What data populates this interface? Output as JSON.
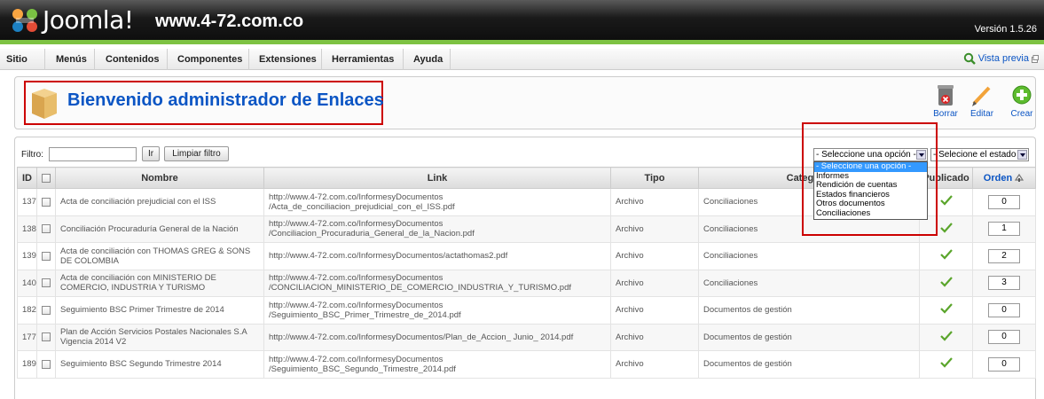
{
  "header": {
    "brand": "Joomla!",
    "site": "www.4-72.com.co",
    "version": "Versión 1.5.26"
  },
  "menu": [
    "Sitio",
    "Menús",
    "Contenidos",
    "Componentes",
    "Extensiones",
    "Herramientas",
    "Ayuda"
  ],
  "preview_label": "Vista previa",
  "page_title": "Bienvenido administrador de Enlaces",
  "toolbar": {
    "delete": "Borrar",
    "edit": "Editar",
    "new": "Crear"
  },
  "filter": {
    "label": "Filtro:",
    "value": "",
    "go": "Ir",
    "reset": "Limpiar filtro",
    "category_select": "- Seleccione una opción -",
    "state_select": "- Selecione el estado -"
  },
  "category_options": [
    "- Seleccione una opción -",
    "Informes",
    "Rendición de cuentas",
    "Estados financieros",
    "Otros documentos",
    "Conciliaciones"
  ],
  "table": {
    "headers": {
      "id": "ID",
      "name": "Nombre",
      "link": "Link",
      "type": "Tipo",
      "category": "Categoría",
      "published": "Publicado",
      "order": "Orden"
    },
    "rows": [
      {
        "id": "137",
        "name": "Acta de conciliación prejudicial con el ISS",
        "link": "http://www.4-72.com.co/InformesyDocumentos\n/Acta_de_conciliacion_prejudicial_con_el_ISS.pdf",
        "type": "Archivo",
        "category": "Conciliaciones",
        "order": "0"
      },
      {
        "id": "138",
        "name": "Conciliación Procuraduría General de la Nación",
        "link": "http://www.4-72.com.co/InformesyDocumentos\n/Conciliacion_Procuraduria_General_de_la_Nacion.pdf",
        "type": "Archivo",
        "category": "Conciliaciones",
        "order": "1"
      },
      {
        "id": "139",
        "name": "Acta de conciliación con THOMAS GREG & SONS DE COLOMBIA",
        "link": "http://www.4-72.com.co/InformesyDocumentos/actathomas2.pdf",
        "type": "Archivo",
        "category": "Conciliaciones",
        "order": "2"
      },
      {
        "id": "140",
        "name": "Acta de conciliación con MINISTERIO DE COMERCIO, INDUSTRIA Y TURISMO",
        "link": "http://www.4-72.com.co/InformesyDocumentos\n/CONCILIACION_MINISTERIO_DE_COMERCIO_INDUSTRIA_Y_TURISMO.pdf",
        "type": "Archivo",
        "category": "Conciliaciones",
        "order": "3"
      },
      {
        "id": "182",
        "name": "Seguimiento BSC Primer Trimestre de 2014",
        "link": "http://www.4-72.com.co/InformesyDocumentos\n/Seguimiento_BSC_Primer_Trimestre_de_2014.pdf",
        "type": "Archivo",
        "category": "Documentos de gestión",
        "order": "0"
      },
      {
        "id": "177",
        "name": "Plan de Acción Servicios Postales Nacionales S.A Vigencia 2014 V2",
        "link": "http://www.4-72.com.co/InformesyDocumentos/Plan_de_Accion_ Junio_ 2014.pdf",
        "type": "Archivo",
        "category": "Documentos de gestión",
        "order": "0"
      },
      {
        "id": "189",
        "name": "Seguimiento BSC Segundo Trimestre 2014",
        "link": "http://www.4-72.com.co/InformesyDocumentos\n/Seguimiento_BSC_Segundo_Trimestre_2014.pdf",
        "type": "Archivo",
        "category": "Documentos de gestión",
        "order": "0"
      }
    ]
  },
  "colors": {
    "link_blue": "#0b55c4",
    "header_dark": "#0c0c0c",
    "accent_green": "#7dc242",
    "highlight_red": "#cc0000",
    "published_green": "#5aa52b"
  }
}
